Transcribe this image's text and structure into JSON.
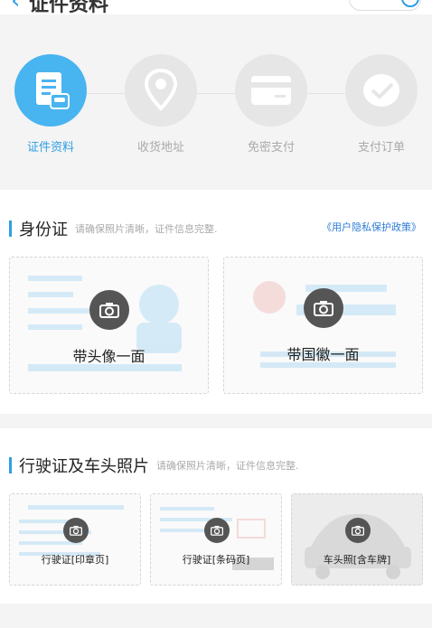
{
  "header": {
    "title": "证件资料"
  },
  "steps": [
    {
      "label": "证件资料",
      "icon": "document-icon",
      "active": true
    },
    {
      "label": "收货地址",
      "icon": "location-pin-icon",
      "active": false
    },
    {
      "label": "免密支付",
      "icon": "card-icon",
      "active": false
    },
    {
      "label": "支付订单",
      "icon": "check-icon",
      "active": false
    }
  ],
  "id_section": {
    "title": "身份证",
    "hint": "请确保照片清晰，证件信息完整.",
    "policy_link": "《用户隐私保护政策》",
    "cards": [
      {
        "caption": "带头像一面"
      },
      {
        "caption": "带国徽一面"
      }
    ]
  },
  "vehicle_section": {
    "title": "行驶证及车头照片",
    "hint": "请确保照片清晰，证件信息完整.",
    "cards": [
      {
        "caption": "行驶证[印章页]"
      },
      {
        "caption": "行驶证[条码页]"
      },
      {
        "caption": "车头照[含车牌]"
      }
    ]
  },
  "colors": {
    "accent": "#2e9fe6",
    "active_step": "#48b4f0",
    "inactive_step": "#e6e6e6"
  }
}
